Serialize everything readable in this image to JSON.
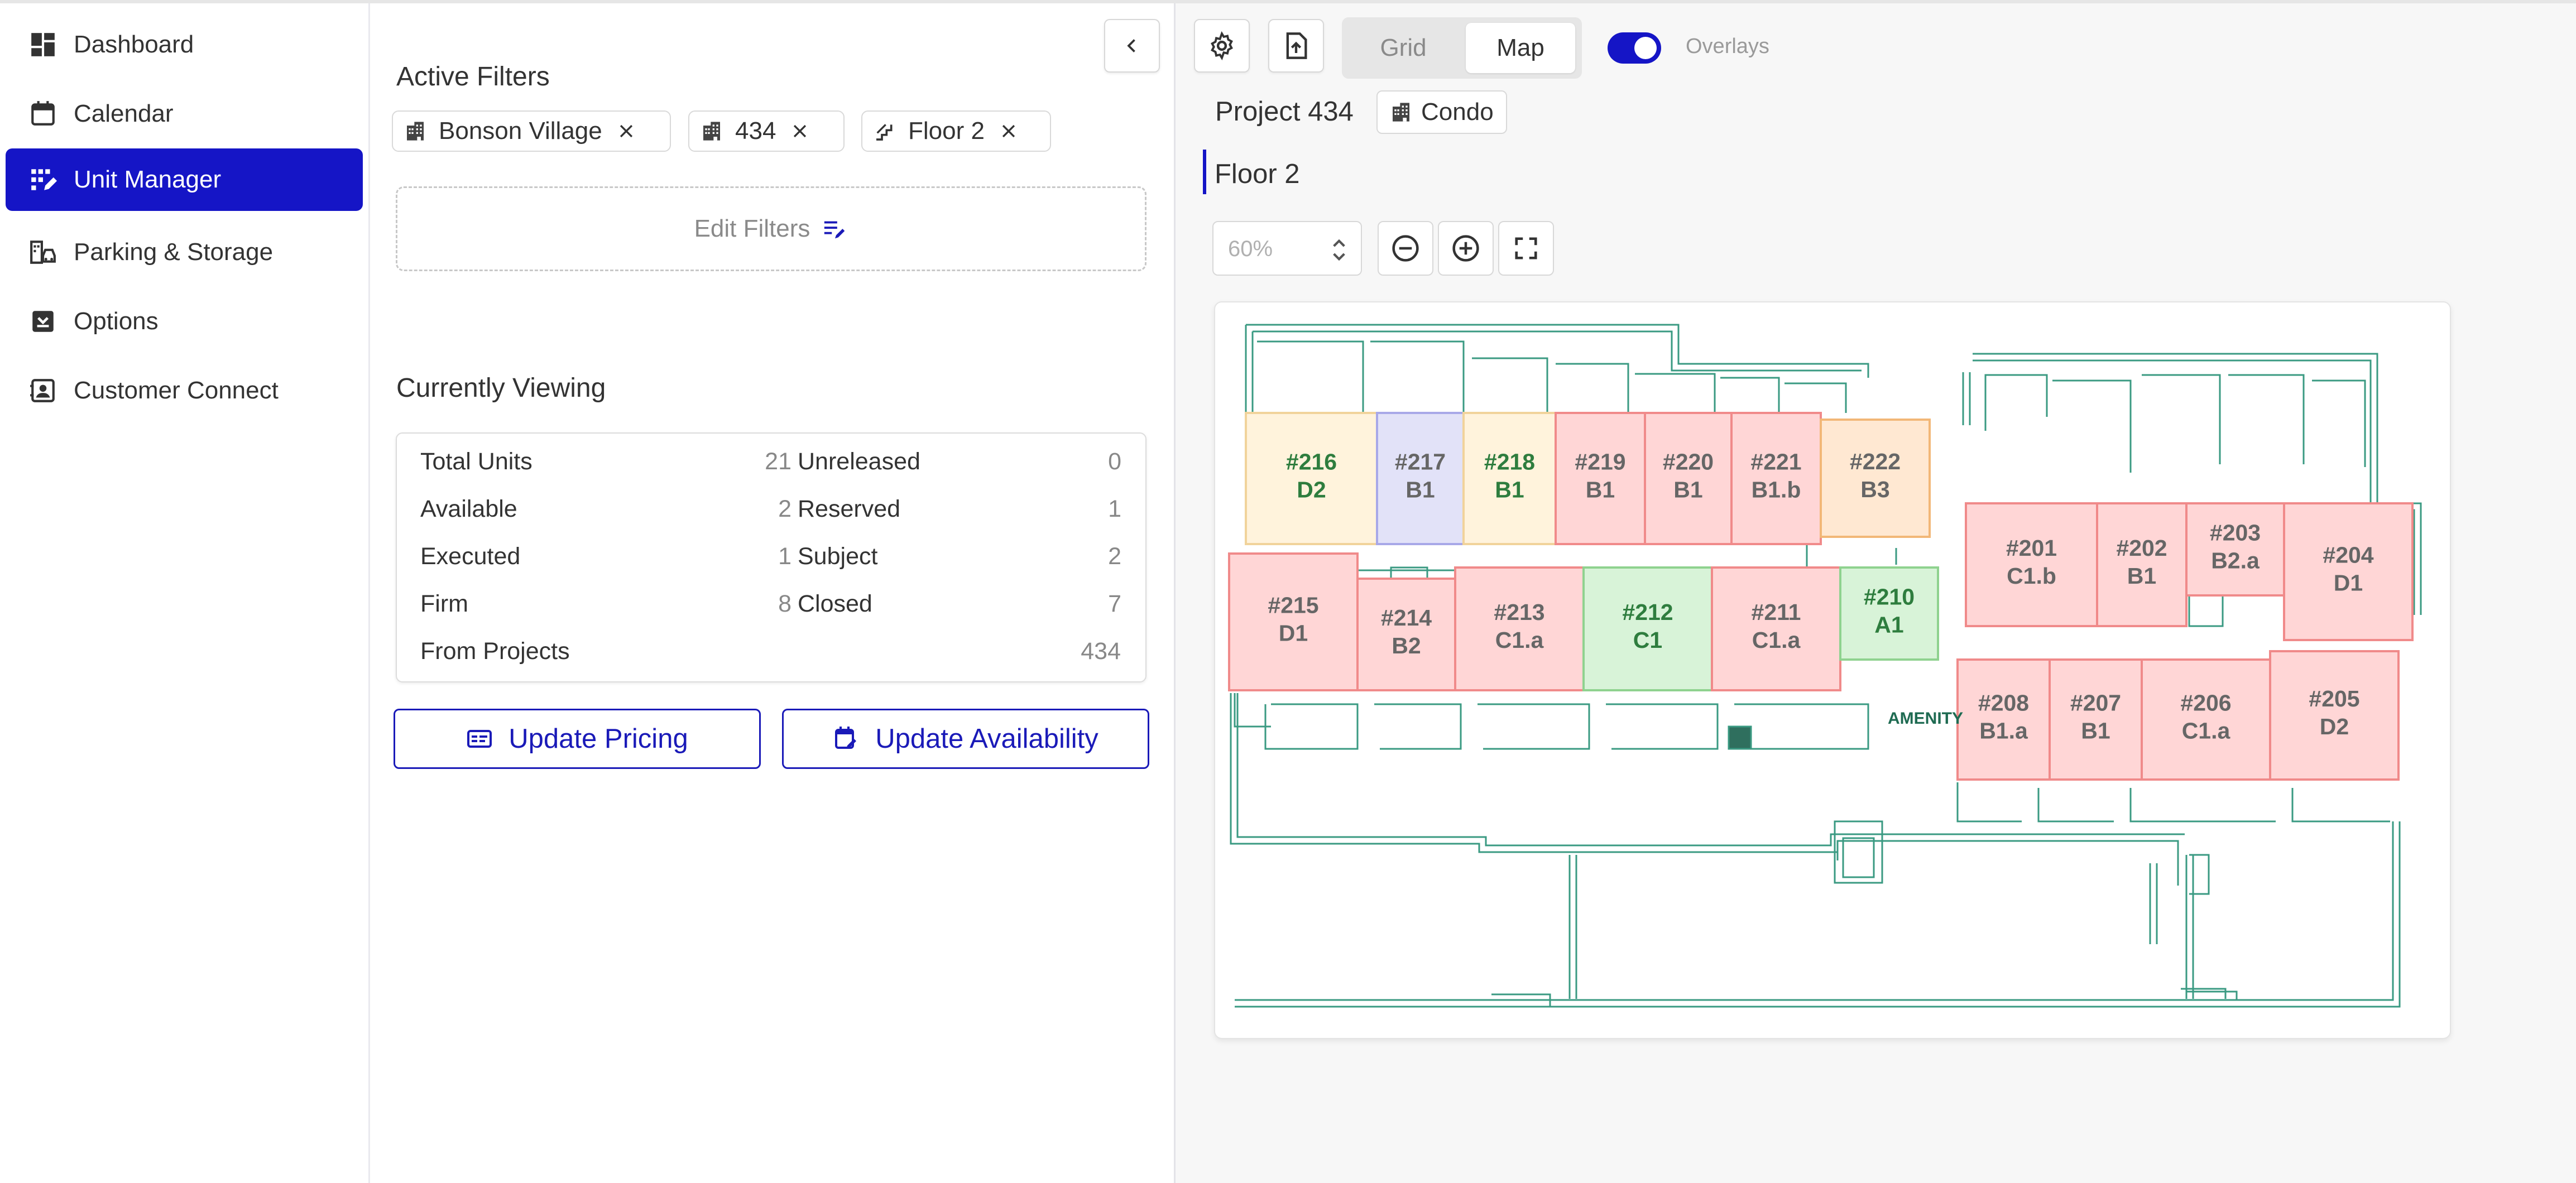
{
  "sidebar": {
    "items": [
      {
        "label": "Dashboard",
        "icon": "dashboard-icon"
      },
      {
        "label": "Calendar",
        "icon": "calendar-icon"
      },
      {
        "label": "Unit Manager",
        "icon": "unit-manager-icon",
        "active": true
      },
      {
        "label": "Parking & Storage",
        "icon": "parking-storage-icon"
      },
      {
        "label": "Options",
        "icon": "options-icon"
      },
      {
        "label": "Customer Connect",
        "icon": "customer-connect-icon"
      }
    ]
  },
  "filters": {
    "title": "Active Filters",
    "chips": [
      {
        "label": "Bonson Village",
        "icon": "building-icon"
      },
      {
        "label": "434",
        "icon": "building-icon"
      },
      {
        "label": "Floor 2",
        "icon": "stairs-icon"
      }
    ],
    "edit_label": "Edit Filters"
  },
  "viewing": {
    "title": "Currently Viewing",
    "stats_left": [
      {
        "label": "Total Units",
        "value": "21"
      },
      {
        "label": "Available",
        "value": "2"
      },
      {
        "label": "Executed",
        "value": "1"
      },
      {
        "label": "Firm",
        "value": "8"
      },
      {
        "label": "From Projects",
        "value": "434"
      }
    ],
    "stats_right": [
      {
        "label": "Unreleased",
        "value": "0"
      },
      {
        "label": "Reserved",
        "value": "1"
      },
      {
        "label": "Subject",
        "value": "2"
      },
      {
        "label": "Closed",
        "value": "7"
      }
    ]
  },
  "actions": {
    "update_pricing": "Update Pricing",
    "update_availability": "Update Availability"
  },
  "toolbar": {
    "view_grid": "Grid",
    "view_map": "Map",
    "overlays_label": "Overlays",
    "overlays_on": true
  },
  "project": {
    "title": "Project 434",
    "type_badge": "Condo",
    "floor": "Floor 2"
  },
  "zoom": {
    "value": "60%"
  },
  "map": {
    "amenity_label": "AMENITY",
    "units": [
      {
        "num": "#216",
        "plan": "D2",
        "status": "available"
      },
      {
        "num": "#217",
        "plan": "B1",
        "status": "reserved"
      },
      {
        "num": "#218",
        "plan": "B1",
        "status": "available"
      },
      {
        "num": "#219",
        "plan": "B1",
        "status": "sold"
      },
      {
        "num": "#220",
        "plan": "B1",
        "status": "sold"
      },
      {
        "num": "#221",
        "plan": "B1.b",
        "status": "sold"
      },
      {
        "num": "#222",
        "plan": "B3",
        "status": "subject"
      },
      {
        "num": "#215",
        "plan": "D1",
        "status": "sold"
      },
      {
        "num": "#214",
        "plan": "B2",
        "status": "sold"
      },
      {
        "num": "#213",
        "plan": "C1.a",
        "status": "sold"
      },
      {
        "num": "#212",
        "plan": "C1",
        "status": "executed"
      },
      {
        "num": "#211",
        "plan": "C1.a",
        "status": "sold"
      },
      {
        "num": "#210",
        "plan": "A1",
        "status": "executed"
      },
      {
        "num": "#201",
        "plan": "C1.b",
        "status": "sold"
      },
      {
        "num": "#202",
        "plan": "B1",
        "status": "sold"
      },
      {
        "num": "#203",
        "plan": "B2.a",
        "status": "sold"
      },
      {
        "num": "#204",
        "plan": "D1",
        "status": "sold"
      },
      {
        "num": "#208",
        "plan": "B1.a",
        "status": "sold"
      },
      {
        "num": "#207",
        "plan": "B1",
        "status": "sold"
      },
      {
        "num": "#206",
        "plan": "C1.a",
        "status": "sold"
      },
      {
        "num": "#205",
        "plan": "D2",
        "status": "sold"
      }
    ],
    "status_colors": {
      "sold": "#ffd6d6",
      "available": "#fff3dc",
      "subject": "#ffe8d2",
      "reserved": "#e2e2f8",
      "executed": "#d8f3d8"
    }
  },
  "colors": {
    "accent": "#1515c6",
    "plan_line": "#2f8a74"
  }
}
